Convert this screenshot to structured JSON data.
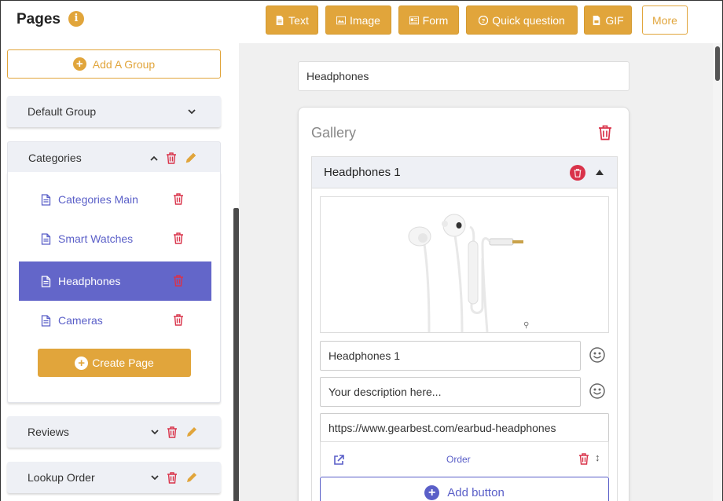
{
  "header": {
    "title": "Pages",
    "info_icon": "info-icon",
    "buttons": [
      {
        "label": "Text",
        "icon": "file-text-icon"
      },
      {
        "label": "Image",
        "icon": "image-icon"
      },
      {
        "label": "Form",
        "icon": "form-icon"
      },
      {
        "label": "Quick question",
        "icon": "question-circle-icon"
      },
      {
        "label": "GIF",
        "icon": "gif-file-icon"
      },
      {
        "label": "More"
      }
    ]
  },
  "sidebar": {
    "add_group_label": "Add A Group",
    "groups": [
      {
        "name": "Default Group",
        "expanded": false
      },
      {
        "name": "Categories",
        "expanded": true
      },
      {
        "name": "Reviews",
        "expanded": false
      },
      {
        "name": "Lookup Order",
        "expanded": false
      }
    ],
    "pages": [
      {
        "label": "Categories Main",
        "active": false
      },
      {
        "label": "Smart Watches",
        "active": false
      },
      {
        "label": "Headphones",
        "active": true
      },
      {
        "label": "Cameras",
        "active": false
      }
    ],
    "create_page_label": "Create Page"
  },
  "main": {
    "page_name_value": "Headphones",
    "gallery": {
      "title": "Gallery",
      "item": {
        "header_title": "Headphones 1",
        "title_value": "Headphones 1",
        "description_placeholder": "Your description here...",
        "url_value": "https://www.gearbest.com/earbud-headphones",
        "button": {
          "label": "Order"
        },
        "add_button_label": "Add button"
      }
    }
  },
  "colors": {
    "accent": "#e1a53b",
    "primary": "#5a5fc8",
    "active_bg": "#6366c9",
    "danger": "#d9334a"
  }
}
